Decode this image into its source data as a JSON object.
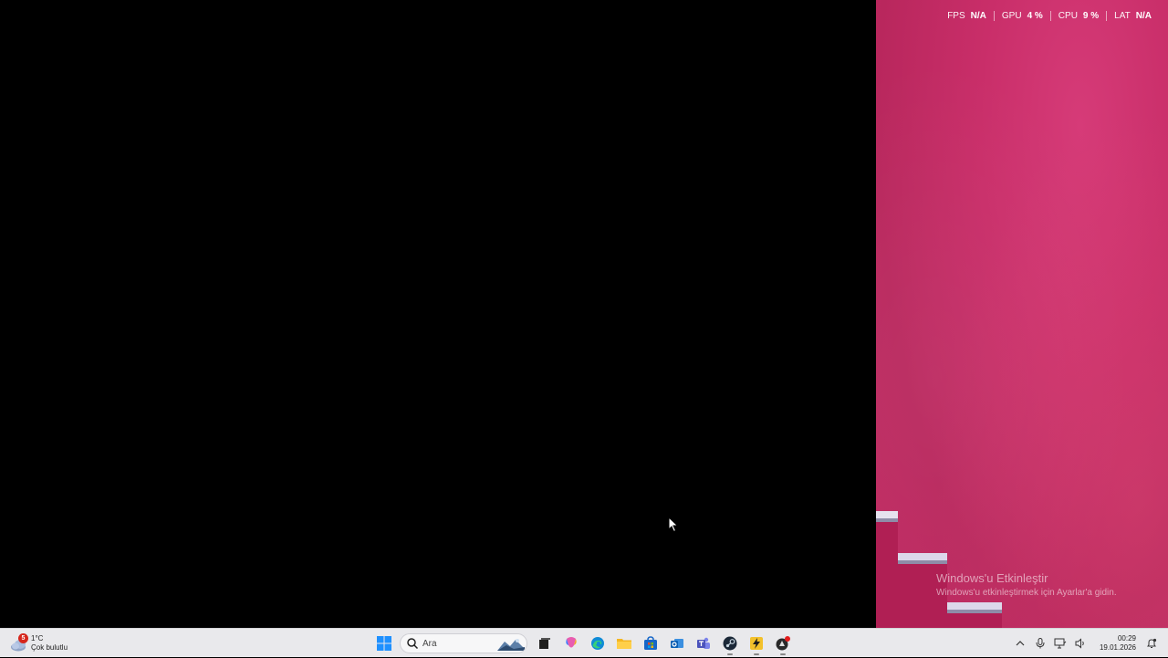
{
  "perf_overlay": {
    "fps": {
      "label": "FPS",
      "value": "N/A"
    },
    "gpu": {
      "label": "GPU",
      "value": "4 %"
    },
    "cpu": {
      "label": "CPU",
      "value": "9 %"
    },
    "lat": {
      "label": "LAT",
      "value": "N/A"
    }
  },
  "activation": {
    "title": "Windows'u Etkinleştir",
    "subtitle": "Windows'u etkinleştirmek için Ayarlar'a gidin."
  },
  "taskbar": {
    "weather": {
      "badge": "5",
      "temperature": "1°C",
      "condition": "Çok bulutlu",
      "icon": "cloudy-weather-icon"
    },
    "search": {
      "placeholder": "Ara"
    },
    "apps": [
      {
        "name": "start",
        "icon": "windows-logo-icon"
      },
      {
        "name": "task-view",
        "icon": "task-view-icon"
      },
      {
        "name": "copilot",
        "icon": "copilot-icon"
      },
      {
        "name": "edge",
        "icon": "edge-icon"
      },
      {
        "name": "file-explorer",
        "icon": "folder-icon"
      },
      {
        "name": "store",
        "icon": "store-icon"
      },
      {
        "name": "outlook",
        "icon": "outlook-icon"
      },
      {
        "name": "teams",
        "icon": "teams-icon"
      },
      {
        "name": "steam",
        "icon": "steam-icon"
      },
      {
        "name": "app-yellow",
        "icon": "lightning-app-icon"
      },
      {
        "name": "app-dark",
        "icon": "dark-app-icon"
      }
    ],
    "clock": {
      "time": "00:29",
      "date": "19.01.2026"
    }
  },
  "colors": {
    "wallpaper": "#c92e69",
    "taskbar": "#e9e9ec"
  }
}
